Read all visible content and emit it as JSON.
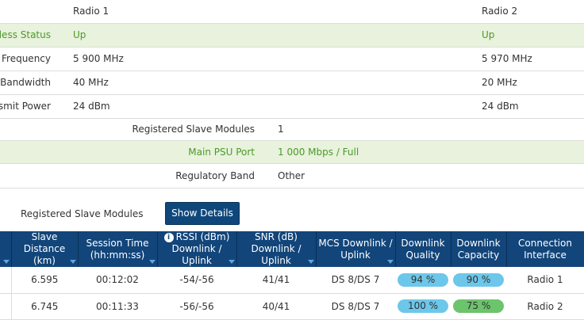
{
  "radio_header": {
    "radio1": "Radio 1",
    "radio2": "Radio 2"
  },
  "radio_rows": [
    {
      "label": "Wireless Status",
      "radio1": "Up",
      "radio2": "Up"
    },
    {
      "label": "Frequency",
      "radio1": "5 900 MHz",
      "radio2": "5 970 MHz"
    },
    {
      "label": "Bandwidth",
      "radio1": "40 MHz",
      "radio2": "20 MHz"
    },
    {
      "label": "Transmit Power",
      "radio1": "24 dBm",
      "radio2": "24 dBm"
    }
  ],
  "info_rows": [
    {
      "label": "Registered Slave Modules",
      "value": "1"
    },
    {
      "label": "Main PSU Port",
      "value": "1 000 Mbps / Full"
    },
    {
      "label": "Regulatory Band",
      "value": "Other"
    }
  ],
  "slave_section": {
    "label": "Registered Slave Modules",
    "button": "Show Details"
  },
  "table": {
    "headers": [
      {
        "line1": "Slave",
        "line2": "Distance",
        "line3": "(km)"
      },
      {
        "line1": "Session Time",
        "line2": "(hh:mm:ss)"
      },
      {
        "line1": "RSSI (dBm)",
        "line2": "Downlink / Uplink"
      },
      {
        "line1": "SNR (dB)",
        "line2": "Downlink / Uplink"
      },
      {
        "line1": "MCS Downlink /",
        "line2": "Uplink"
      },
      {
        "line1": "Downlink",
        "line2": "Quality"
      },
      {
        "line1": "Downlink",
        "line2": "Capacity"
      },
      {
        "line1": "Connection",
        "line2": "Interface"
      }
    ],
    "rows": [
      {
        "distance": "6.595",
        "session": "00:12:02",
        "rssi": "-54/-56",
        "snr": "41/41",
        "mcs": "DS 8/DS 7",
        "quality": "94 %",
        "capacity": "90 %",
        "interface": "Radio 1"
      },
      {
        "distance": "6.745",
        "session": "00:11:33",
        "rssi": "-56/-56",
        "snr": "40/41",
        "mcs": "DS 8/DS 7",
        "quality": "100 %",
        "capacity": "75 %",
        "interface": "Radio 2"
      }
    ]
  },
  "colors": {
    "status_green_text": "#4c9a2a",
    "status_green_bg": "#e8f2dc",
    "header_blue": "#12457a",
    "quality_blue": "#6cc7ea",
    "capacity_green": "#6cc46c"
  },
  "icons": {
    "rssi_info": "info-icon"
  }
}
